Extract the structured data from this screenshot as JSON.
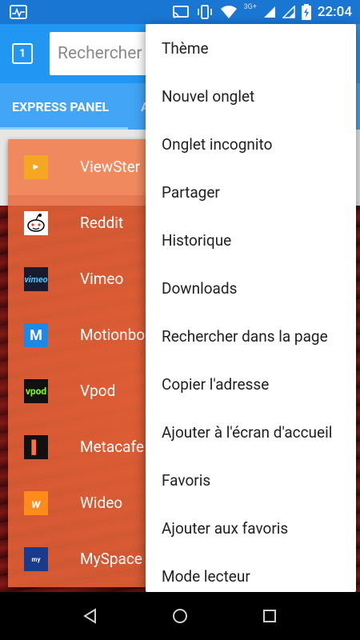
{
  "status_bar": {
    "time": "22:04",
    "network": "3G+",
    "icons": [
      "activity-icon",
      "cast-icon",
      "vibrate-icon",
      "wifi-icon",
      "signal-icon",
      "signal-icon",
      "battery-charging-icon"
    ]
  },
  "toolbar": {
    "tab_count": "1",
    "search_placeholder": "Rechercher"
  },
  "panel_tabs": {
    "active": "EXPRESS PANEL",
    "next": "A"
  },
  "sites": [
    {
      "name": "ViewSter",
      "logo": "viewster",
      "color": "#f5a623"
    },
    {
      "name": "Reddit",
      "logo": "reddit",
      "color": "#ffffff"
    },
    {
      "name": "Vimeo",
      "logo": "vimeo",
      "color": "#1a1a2e"
    },
    {
      "name": "Motionbo",
      "logo": "M",
      "color": "#1e88e5"
    },
    {
      "name": "Vpod",
      "logo": "vpod",
      "color": "#111111"
    },
    {
      "name": "Metacafe",
      "logo": "metacafe",
      "color": "#111111"
    },
    {
      "name": "Wideo",
      "logo": "W",
      "color": "#ff8c1a"
    },
    {
      "name": "MySpace",
      "logo": "myspace",
      "color": "#1a3a8c"
    }
  ],
  "menu": {
    "items": [
      "Thème",
      "Nouvel onglet",
      "Onglet incognito",
      "Partager",
      "Historique",
      "Downloads",
      "Rechercher dans la page",
      "Copier l'adresse",
      "Ajouter à l'écran d'accueil",
      "Favoris",
      "Ajouter aux favoris",
      "Mode lecteur"
    ]
  },
  "nav": {
    "back": "back-icon",
    "home": "home-icon",
    "recents": "recents-icon"
  }
}
